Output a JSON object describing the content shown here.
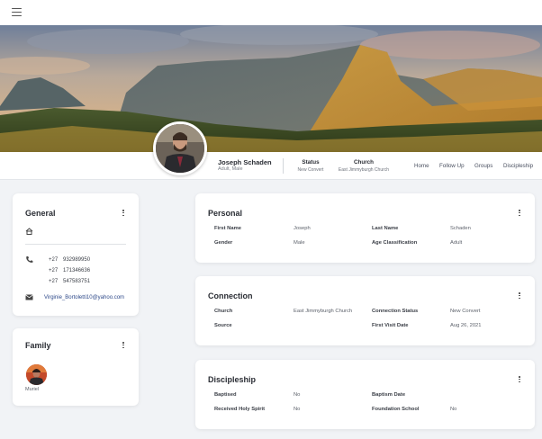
{
  "topbar": {
    "menu_icon": "hamburger-menu-icon"
  },
  "profile": {
    "name": "Joseph Schaden",
    "subtitle": "Adult, Male",
    "status_label": "Status",
    "status_value": "New Convert",
    "church_label": "Church",
    "church_value": "East Jimmyburgh Church"
  },
  "tabs": [
    "Home",
    "Follow Up",
    "Groups",
    "Discipleship"
  ],
  "general": {
    "title": "General",
    "phones": [
      {
        "code": "+27",
        "number": "932989950"
      },
      {
        "code": "+27",
        "number": "171346636"
      },
      {
        "code": "+27",
        "number": "547583751"
      }
    ],
    "email": "Virginie_Bortoletti10@yahoo.com",
    "icons": {
      "home": "home-icon",
      "phone": "phone-icon",
      "email": "email-icon"
    }
  },
  "family": {
    "title": "Family",
    "members": [
      {
        "name": "Muriel"
      }
    ]
  },
  "personal": {
    "title": "Personal",
    "fields": {
      "first_name_label": "First Name",
      "first_name": "Joseph",
      "last_name_label": "Last Name",
      "last_name": "Schaden",
      "gender_label": "Gender",
      "gender": "Male",
      "age_label": "Age Classification",
      "age": "Adult"
    }
  },
  "connection": {
    "title": "Connection",
    "fields": {
      "church_label": "Church",
      "church": "East Jimmyburgh Church",
      "status_label": "Connection Status",
      "status": "New Convert",
      "source_label": "Source",
      "source": "",
      "visit_label": "First Visit Date",
      "visit": "Aug 26, 2021"
    }
  },
  "discipleship": {
    "title": "Discipleship",
    "fields": {
      "baptised_label": "Baptised",
      "baptised": "No",
      "baptism_date_label": "Baptism Date",
      "baptism_date": "",
      "holy_spirit_label": "Received Holy Spirit",
      "holy_spirit": "No",
      "foundation_label": "Foundation School",
      "foundation": "No"
    }
  },
  "colors": {
    "background": "#f1f3f6",
    "card": "#ffffff",
    "text": "#2a2d34",
    "link": "#2f4a8a"
  }
}
